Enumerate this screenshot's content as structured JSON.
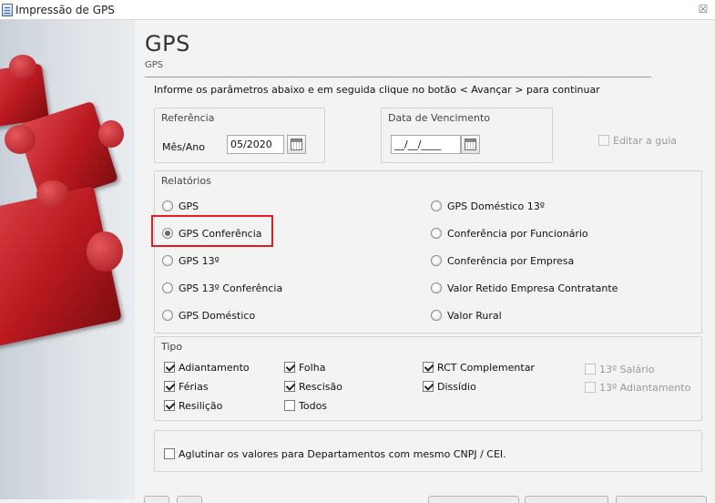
{
  "window": {
    "title": "Impressão de GPS",
    "close_symbol": "☒"
  },
  "header": {
    "title": "GPS",
    "subtitle": "GPS",
    "instruction": "Informe os parâmetros abaixo e em seguida clique no botão < Avançar > para continuar"
  },
  "referencia": {
    "group_label": "Referência",
    "mes_ano_label": "Mês/Ano",
    "mes_ano_value": "05/2020"
  },
  "vencimento": {
    "group_label": "Data de Vencimento",
    "value": "__/__/____"
  },
  "editar_guia": {
    "label": "Editar a guia",
    "checked": false,
    "enabled": false
  },
  "relatorios": {
    "group_label": "Relatórios",
    "selected": "GPS Conferência",
    "left": [
      "GPS",
      "GPS Conferência",
      "GPS 13º",
      "GPS 13º Conferência",
      "GPS Doméstico"
    ],
    "right": [
      "GPS Doméstico 13º",
      "Conferência por Funcionário",
      "Conferência por Empresa",
      "Valor Retido Empresa Contratante",
      "Valor Rural"
    ]
  },
  "tipo": {
    "group_label": "Tipo",
    "items": [
      {
        "label": "Adiantamento",
        "checked": true,
        "enabled": true
      },
      {
        "label": "Férias",
        "checked": true,
        "enabled": true
      },
      {
        "label": "Resilição",
        "checked": true,
        "enabled": true
      },
      {
        "label": "Folha",
        "checked": true,
        "enabled": true
      },
      {
        "label": "Rescisão",
        "checked": true,
        "enabled": true
      },
      {
        "label": "Todos",
        "checked": false,
        "enabled": true
      },
      {
        "label": "RCT Complementar",
        "checked": true,
        "enabled": true
      },
      {
        "label": "Dissídio",
        "checked": true,
        "enabled": true
      },
      {
        "label": "13º Salário",
        "checked": false,
        "enabled": false
      },
      {
        "label": "13º Adiantamento",
        "checked": false,
        "enabled": false
      }
    ]
  },
  "aglutinar": {
    "label": "Aglutinar os valores para Departamentos com mesmo CNPJ / CEI.",
    "checked": false
  },
  "colors": {
    "highlight": "#e01b24",
    "puzzle_red": "#b8191f"
  }
}
